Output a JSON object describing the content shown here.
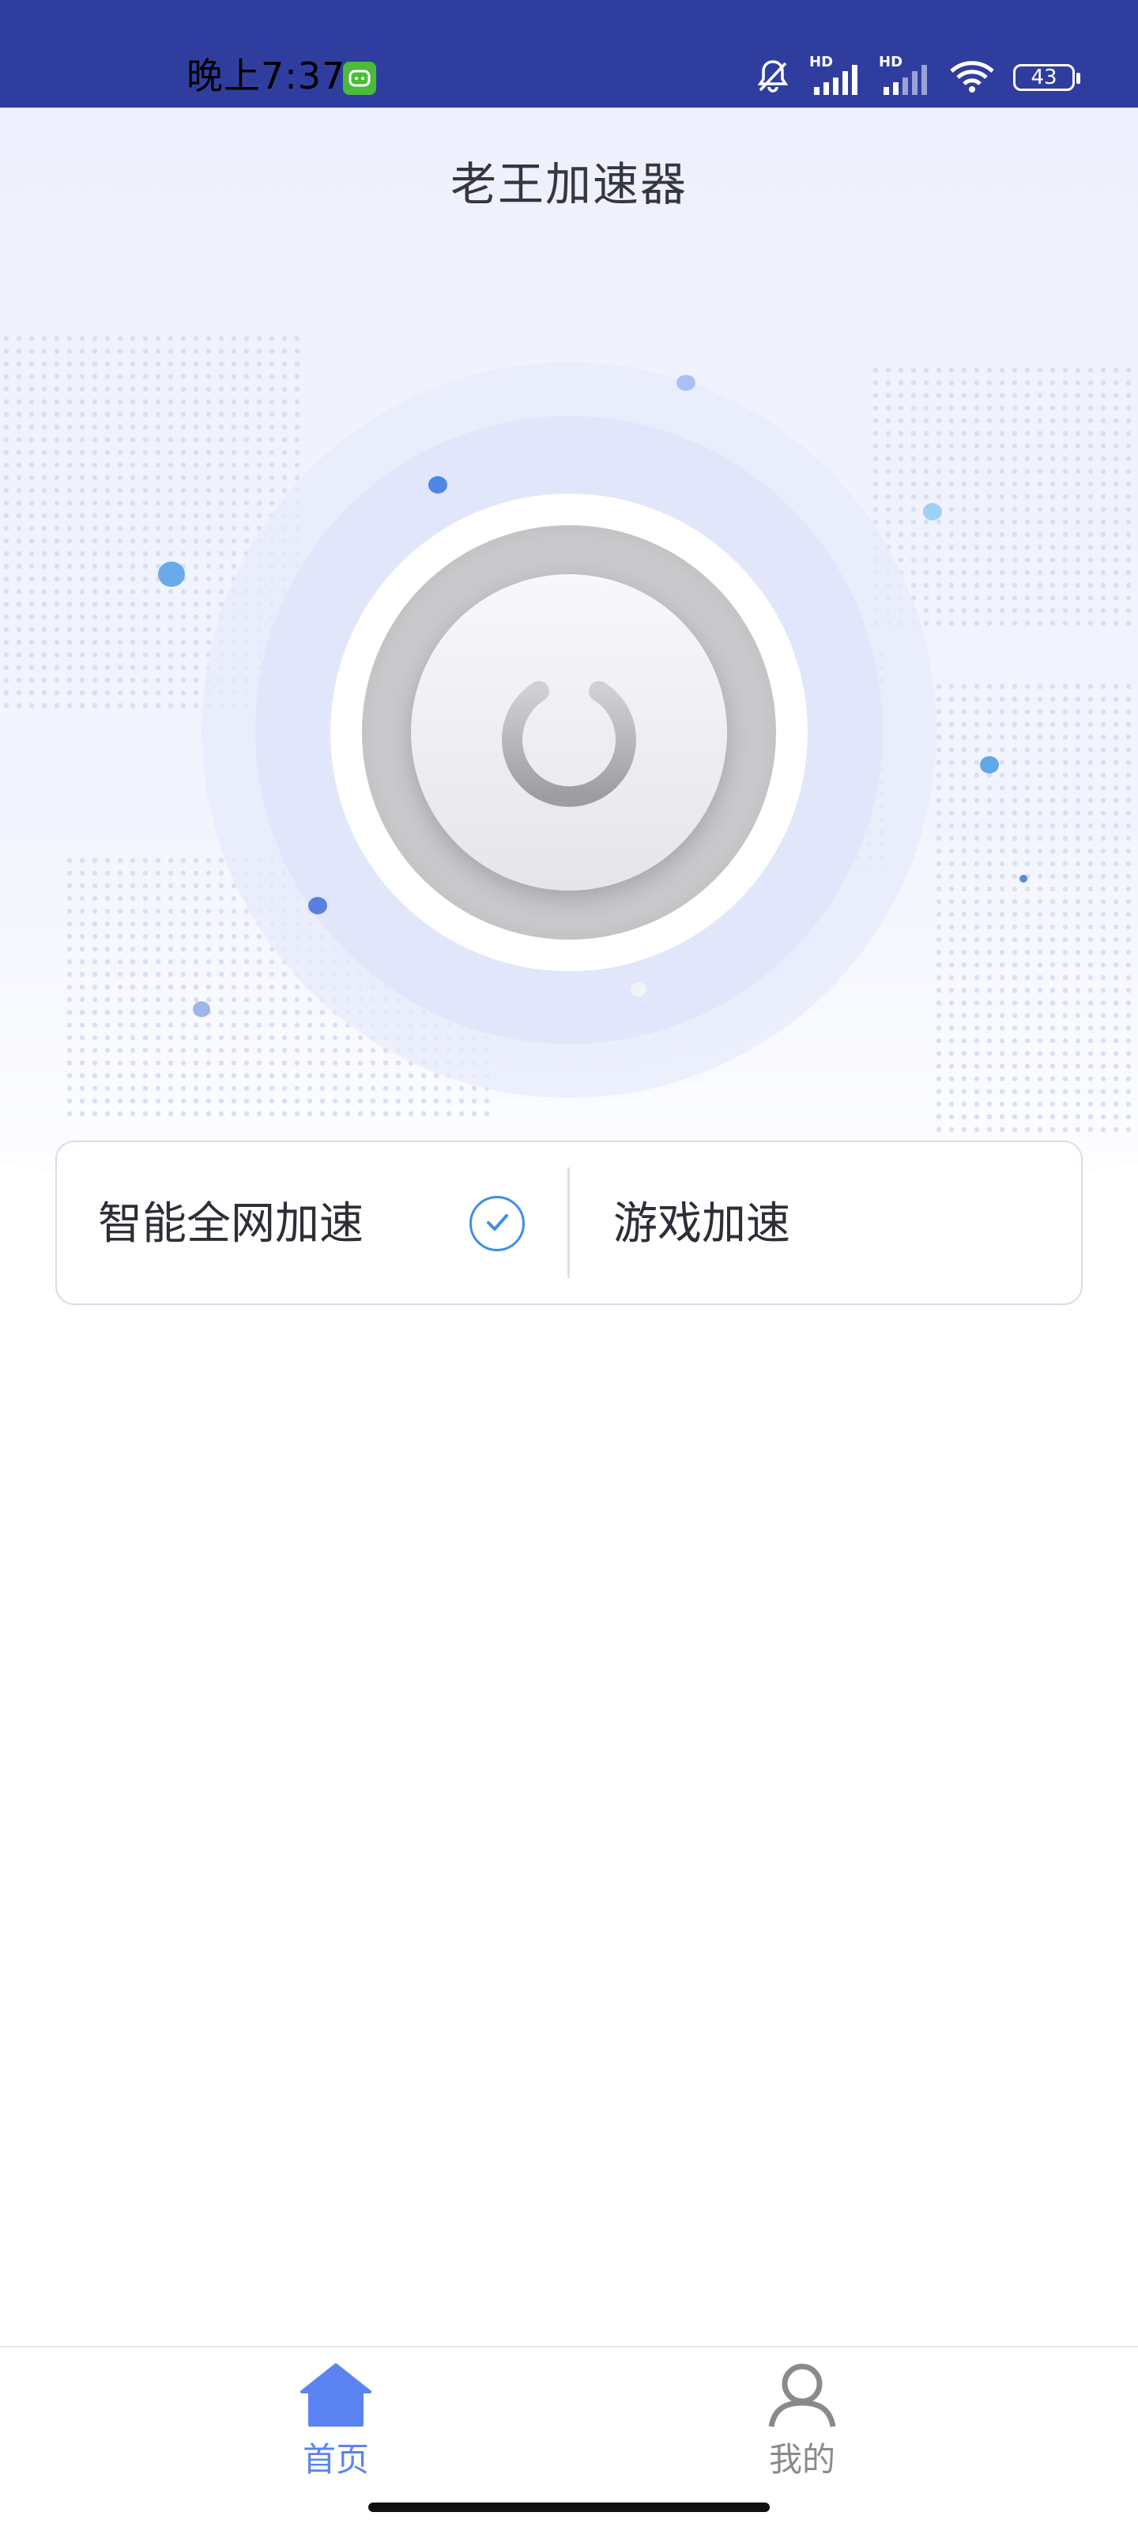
{
  "status_bar": {
    "time": "晚上7:37",
    "battery": "43",
    "signal_badge_1": "HD",
    "signal_badge_2": "HD"
  },
  "header": {
    "title": "老王加速器"
  },
  "modes": {
    "smart_label": "智能全网加速",
    "game_label": "游戏加速",
    "selected": "智能全网加速"
  },
  "bottom_nav": {
    "home_label": "首页",
    "mine_label": "我的"
  },
  "colors": {
    "status_bar": "#2f3e9e",
    "accent": "#5b84f2",
    "check": "#3f8ee6",
    "inactive": "#8a8a8a"
  }
}
